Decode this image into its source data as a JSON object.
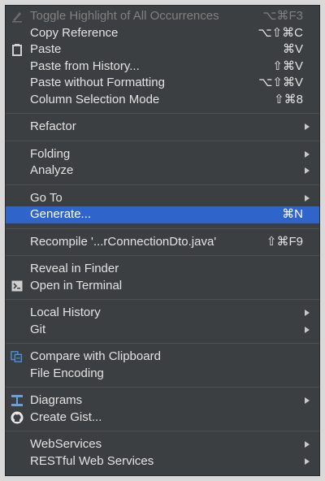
{
  "menu": {
    "items": [
      {
        "label": "Toggle Highlight of All Occurrences",
        "shortcut": "⌥⌘F3",
        "icon": "highlight-pen-icon",
        "disabled": true
      },
      {
        "label": "Copy Reference",
        "shortcut": "⌥⇧⌘C"
      },
      {
        "label": "Paste",
        "shortcut": "⌘V",
        "icon": "clipboard-icon"
      },
      {
        "label": "Paste from History...",
        "shortcut": "⇧⌘V"
      },
      {
        "label": "Paste without Formatting",
        "shortcut": "⌥⇧⌘V"
      },
      {
        "label": "Column Selection Mode",
        "shortcut": "⇧⌘8"
      },
      {
        "separator": true
      },
      {
        "label": "Refactor",
        "submenu": true
      },
      {
        "separator": true
      },
      {
        "label": "Folding",
        "submenu": true
      },
      {
        "label": "Analyze",
        "submenu": true
      },
      {
        "separator": true
      },
      {
        "label": "Go To",
        "submenu": true
      },
      {
        "label": "Generate...",
        "shortcut": "⌘N",
        "selected": true
      },
      {
        "separator": true
      },
      {
        "label": "Recompile '...rConnectionDto.java'",
        "shortcut": "⇧⌘F9"
      },
      {
        "separator": true
      },
      {
        "label": "Reveal in Finder"
      },
      {
        "label": "Open in Terminal",
        "icon": "terminal-icon"
      },
      {
        "separator": true
      },
      {
        "label": "Local History",
        "submenu": true
      },
      {
        "label": "Git",
        "submenu": true
      },
      {
        "separator": true
      },
      {
        "label": "Compare with Clipboard",
        "icon": "compare-icon"
      },
      {
        "label": "File Encoding"
      },
      {
        "separator": true
      },
      {
        "label": "Diagrams",
        "submenu": true,
        "icon": "diagram-icon"
      },
      {
        "label": "Create Gist...",
        "icon": "github-icon"
      },
      {
        "separator": true
      },
      {
        "label": "WebServices",
        "submenu": true
      },
      {
        "label": "RESTful Web Services",
        "submenu": true
      }
    ]
  },
  "colors": {
    "menu_background": "#3c3f41",
    "selection": "#2f65ca",
    "text": "#e3e3e3",
    "disabled_text": "#808080"
  }
}
